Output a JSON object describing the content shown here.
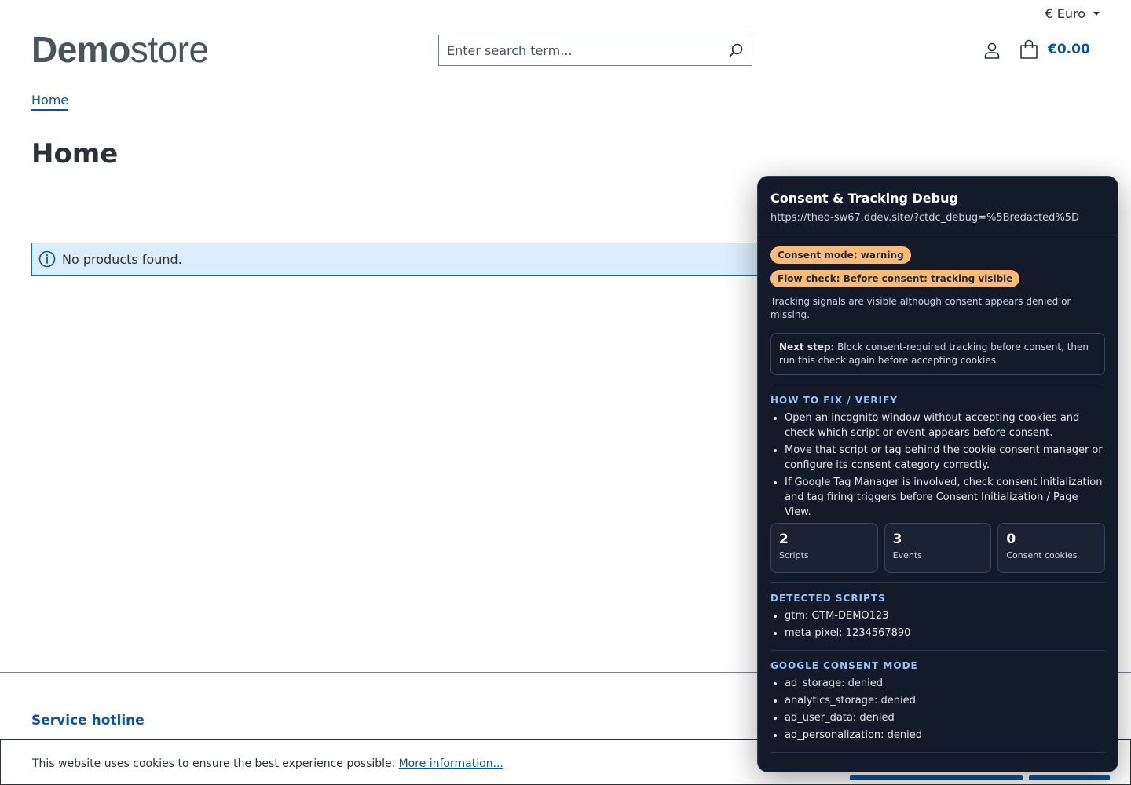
{
  "header": {
    "currency": "€ Euro",
    "logo_bold": "Demo",
    "logo_light": "store",
    "search_placeholder": "Enter search term...",
    "cart_total": "€0.00"
  },
  "breadcrumb": {
    "home": "Home"
  },
  "page": {
    "title": "Home",
    "alert": "No products found."
  },
  "footer": {
    "hotline": "Service hotline"
  },
  "cookie": {
    "text": "This website uses cookies to ensure the best experience possible.",
    "link": "More information..."
  },
  "debug": {
    "title": "Consent & Tracking Debug",
    "url": "https://theo-sw67.ddev.site/?ctdc_debug=%5Bredacted%5D",
    "badge_mode": "Consent mode: warning",
    "badge_flow": "Flow check: Before consent: tracking visible",
    "note": "Tracking signals are visible although consent appears denied or missing.",
    "next_step_label": "Next step:",
    "next_step_text": "Block consent-required tracking before consent, then run this check again before accepting cookies.",
    "fix_title": "HOW TO FIX / VERIFY",
    "fix_items": [
      "Open an incognito window without accepting cookies and check which script or event appears before consent.",
      "Move that script or tag behind the cookie consent manager or configure its consent category correctly.",
      "If Google Tag Manager is involved, check consent initialization and tag firing triggers before Consent Initialization / Page View."
    ],
    "stats": [
      {
        "num": "2",
        "label": "Scripts"
      },
      {
        "num": "3",
        "label": "Events"
      },
      {
        "num": "0",
        "label": "Consent cookies"
      }
    ],
    "scripts_title": "DETECTED SCRIPTS",
    "scripts": [
      "gtm: GTM-DEMO123",
      "meta-pixel: 1234567890"
    ],
    "consent_title": "GOOGLE CONSENT MODE",
    "consent": [
      "ad_storage: denied",
      "analytics_storage: denied",
      "ad_user_data: denied",
      "ad_personalization: denied"
    ]
  },
  "colors": {
    "brand": "#0b539b",
    "panel_bg": "#131a2a",
    "badge": "#fdba74",
    "section_title": "#93c5fd"
  },
  "icons": {
    "search": "search-icon",
    "account": "user-icon",
    "cart": "shopping-bag-icon",
    "info": "info-icon",
    "caret": "caret-down-icon"
  }
}
